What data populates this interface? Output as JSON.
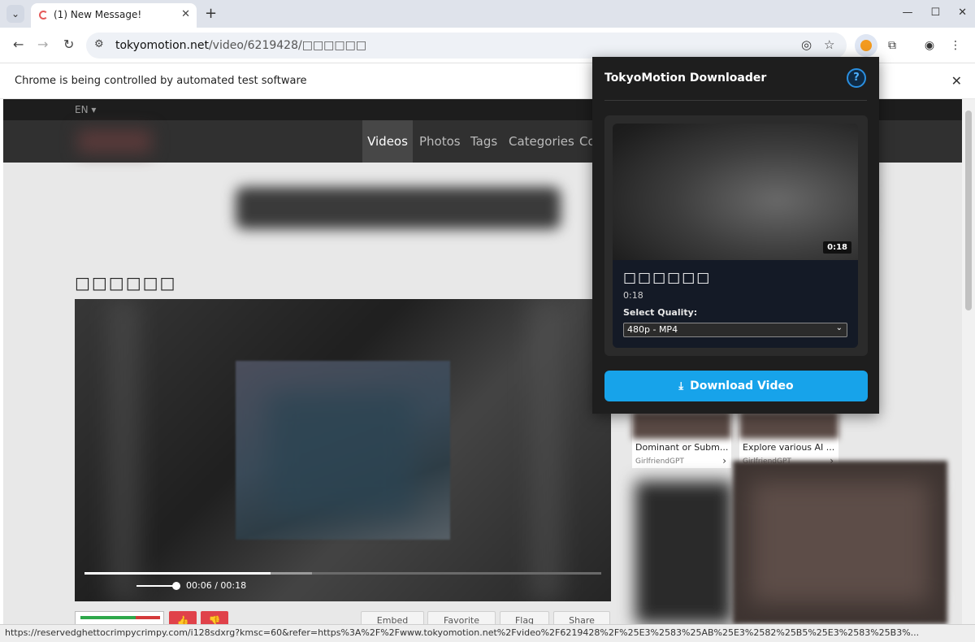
{
  "browser": {
    "tab_title": "(1) New Message!",
    "new_tab": "+",
    "url_host": "tokyomotion.net",
    "url_path": "/video/6219428/□□□□□□",
    "infobar_text": "Chrome is being controlled by automated test software",
    "status_url": "https://reservedghettocrimpycrimpy.com/i128sdxrg?kmsc=60&refer=https%3A%2F%2Fwww.tokyomotion.net%2Fvideo%2F6219428%2F%25E3%2583%25AB%25E3%2582%25B5%25E3%2583%25B3%..."
  },
  "site": {
    "lang": "EN ▾",
    "nav": [
      "Videos",
      "Photos",
      "Tags",
      "Categories",
      "Co"
    ],
    "active_nav": "Videos",
    "video_title": "□□□□□□",
    "player_time": "00:06 / 00:18",
    "actions": {
      "embed": "Embed",
      "favorite": "Favorite",
      "flag": "Flag",
      "share": "Share"
    },
    "sidebar_cards": [
      {
        "title": "Dominant or Subm...",
        "sub": "GirlfriendGPT"
      },
      {
        "title": "Explore various AI ...",
        "sub": "GirlfriendGPT"
      }
    ]
  },
  "popup": {
    "title": "TokyoMotion Downloader",
    "help": "?",
    "video_title": "□□□□□□",
    "duration_badge": "0:18",
    "duration": "0:18",
    "quality_label": "Select Quality:",
    "quality_value": "480p - MP4",
    "download_label": "Download Video"
  },
  "player_progress": {
    "played": 0.36,
    "buffered": 0.44
  }
}
